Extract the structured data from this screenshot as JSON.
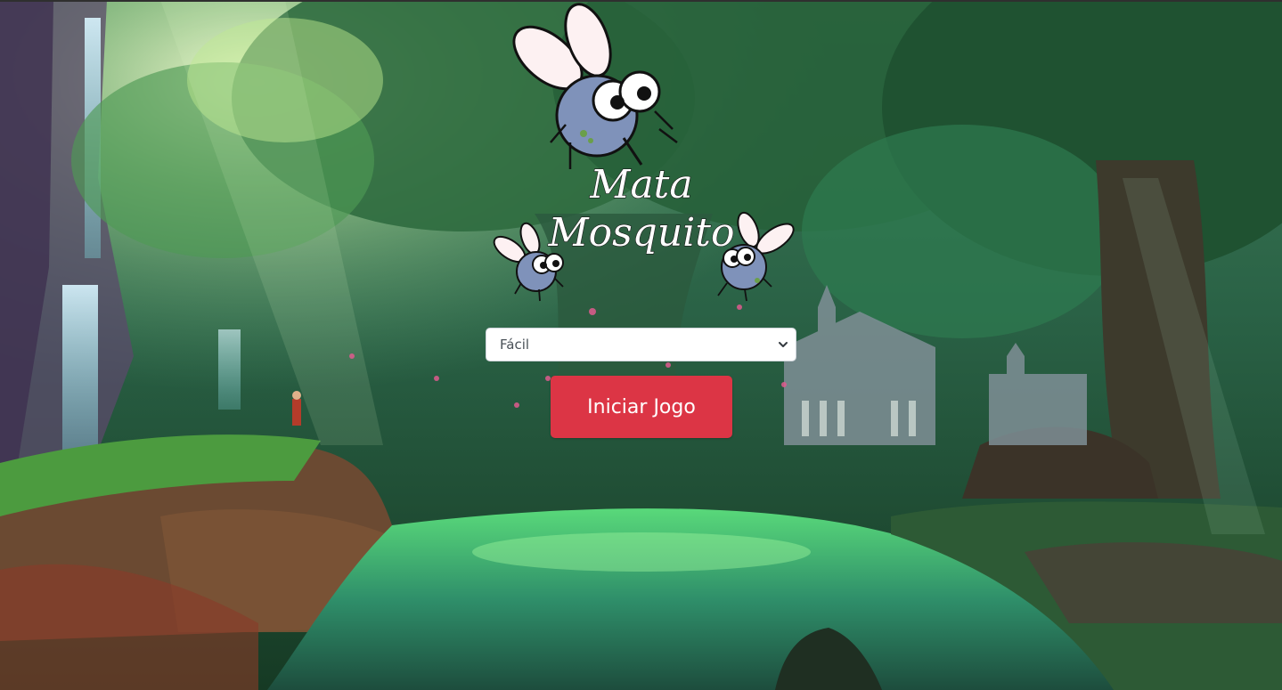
{
  "logo": {
    "line1": "Mata",
    "line2": "Mosquito",
    "alt": "Mata Mosquito logo"
  },
  "difficulty": {
    "selected": "Fácil"
  },
  "start_button": {
    "label": "Iniciar Jogo"
  },
  "colors": {
    "button_bg": "#dc3545",
    "button_text": "#ffffff",
    "select_bg": "#ffffff"
  },
  "icons": {
    "mosquito": "mosquito-icon",
    "dropdown": "chevron-down-icon"
  }
}
